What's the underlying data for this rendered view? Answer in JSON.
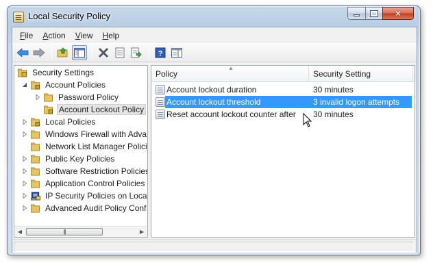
{
  "window": {
    "title": "Local Security Policy"
  },
  "menu": [
    {
      "label": "File",
      "accel": "F",
      "rest": "ile"
    },
    {
      "label": "Action",
      "accel": "A",
      "rest": "ction"
    },
    {
      "label": "View",
      "accel": "V",
      "rest": "iew"
    },
    {
      "label": "Help",
      "accel": "H",
      "rest": "elp"
    }
  ],
  "toolbar": [
    "back-icon",
    "forward-icon",
    "up-folder-icon",
    "show-hide-tree-icon",
    "delete-icon",
    "properties-icon",
    "export-list-icon",
    "help-icon",
    "show-action-pane-icon"
  ],
  "tree": {
    "root": "Security Settings",
    "items": [
      {
        "label": "Account Policies"
      },
      {
        "label": "Password Policy"
      },
      {
        "label": "Account Lockout Policy"
      },
      {
        "label": "Local Policies"
      },
      {
        "label": "Windows Firewall with Adva"
      },
      {
        "label": "Network List Manager Policie"
      },
      {
        "label": "Public Key Policies"
      },
      {
        "label": "Software Restriction Policies"
      },
      {
        "label": "Application Control Policies"
      },
      {
        "label": "IP Security Policies on Local"
      },
      {
        "label": "Advanced Audit Policy Conf"
      }
    ]
  },
  "list": {
    "columns": [
      "Policy",
      "Security Setting"
    ],
    "rows": [
      {
        "policy": "Account lockout duration",
        "setting": "30 minutes"
      },
      {
        "policy": "Account lockout threshold",
        "setting": "3 invalid logon attempts"
      },
      {
        "policy": "Reset account lockout counter after",
        "setting": "30 minutes"
      }
    ],
    "selected_row": 1
  },
  "colors": {
    "selection": "#3399ff",
    "folder": "#e8c560"
  }
}
